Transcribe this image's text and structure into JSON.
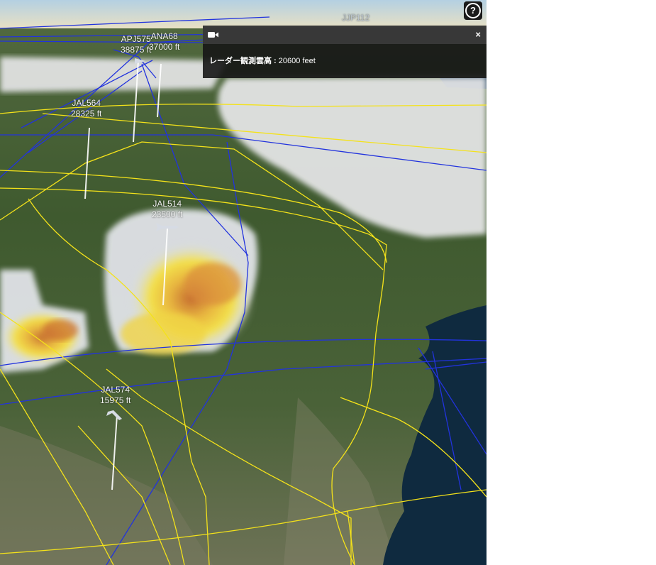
{
  "help": {
    "label": "?"
  },
  "popup": {
    "field_label": "レーダー観測雲高 :",
    "field_value": "20600 feet",
    "close_label": "×"
  },
  "aircraft": [
    {
      "callsign": "JJP112",
      "altitude": ""
    },
    {
      "callsign": "APJ575",
      "altitude": "38875 ft"
    },
    {
      "callsign": "ANA68",
      "altitude": "37000 ft"
    },
    {
      "callsign": "JAL564",
      "altitude": "28325 ft"
    },
    {
      "callsign": "JAL514",
      "altitude": "23500 ft"
    },
    {
      "callsign": "JAL574",
      "altitude": "15975 ft"
    }
  ],
  "colors": {
    "flight_track_blue": "#2233dd",
    "flight_track_yellow": "#f4e21a",
    "ocean": "#0f2a3f",
    "terrain": "#3e5a30",
    "cloud": "#e4e4e6"
  }
}
